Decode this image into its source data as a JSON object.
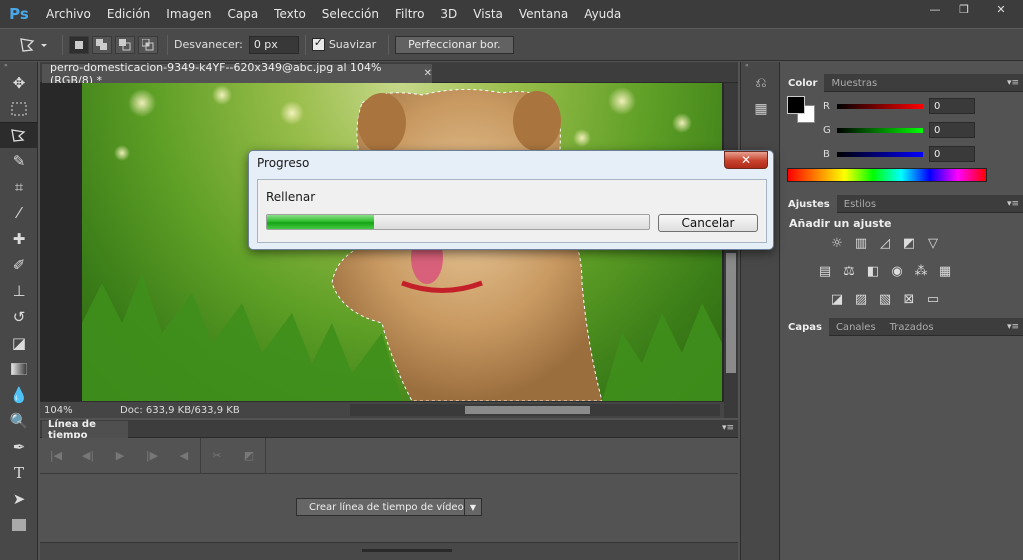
{
  "app": {
    "logo": "Ps"
  },
  "menu": [
    "Archivo",
    "Edición",
    "Imagen",
    "Capa",
    "Texto",
    "Selección",
    "Filtro",
    "3D",
    "Vista",
    "Ventana",
    "Ayuda"
  ],
  "window_controls": {
    "minimize": "—",
    "restore": "❐",
    "close": "✕"
  },
  "options": {
    "feather_label": "Desvanecer:",
    "feather_value": "0 px",
    "smooth_label": "Suavizar",
    "refine_label": "Perfeccionar bor."
  },
  "document": {
    "tab_title": "perro-domesticacion-9349-k4YF--620x349@abc.jpg al 104% (RGB/8) *",
    "tab_close": "✕",
    "zoom": "104%",
    "doc_info": "Doc: 633,9 KB/633,9 KB"
  },
  "timeline": {
    "tab_label": "Línea de tiempo",
    "create_button": "Crear línea de tiempo de vídeo"
  },
  "color_panel": {
    "tabs": [
      "Color",
      "Muestras"
    ],
    "channels": [
      {
        "label": "R",
        "value": "0"
      },
      {
        "label": "G",
        "value": "0"
      },
      {
        "label": "B",
        "value": "0"
      }
    ]
  },
  "adjust_panel": {
    "tabs": [
      "Ajustes",
      "Estilos"
    ],
    "title": "Añadir un ajuste"
  },
  "layers_panel": {
    "tabs": [
      "Capas",
      "Canales",
      "Trazados"
    ]
  },
  "dialog": {
    "title": "Progreso",
    "close": "✕",
    "label": "Rellenar",
    "progress": 0.28,
    "cancel": "Cancelar"
  },
  "colors": {
    "accent": "#4aa8e8",
    "progress_green": "#2fbf2f"
  }
}
